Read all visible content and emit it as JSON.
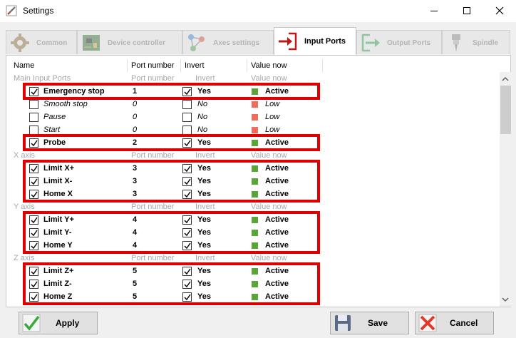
{
  "window": {
    "title": "Settings",
    "icon": "settings-pencil-icon"
  },
  "tabs": [
    {
      "label": "Common",
      "icon": "gear-icon",
      "active": false
    },
    {
      "label": "Device controller",
      "icon": "circuit-board-icon",
      "active": false
    },
    {
      "label": "Axes settings",
      "icon": "axes-nodes-icon",
      "active": false
    },
    {
      "label": "Input Ports",
      "icon": "input-arrow-icon",
      "active": true
    },
    {
      "label": "Output Ports",
      "icon": "output-arrow-icon",
      "active": false
    },
    {
      "label": "Spindle",
      "icon": "spindle-drill-icon",
      "active": false
    }
  ],
  "table": {
    "columns": [
      "Name",
      "Port number",
      "Invert",
      "Value now"
    ],
    "rows": [
      {
        "kind": "group",
        "name": "Main Input Ports",
        "port": "Port number",
        "invert": "Invert",
        "value": "Value now"
      },
      {
        "kind": "signal",
        "enabled": true,
        "name": "Emergency stop",
        "port": "1",
        "invert_checked": true,
        "invert": "Yes",
        "value": "Active",
        "status": "active"
      },
      {
        "kind": "signal",
        "enabled": false,
        "name": "Smooth stop",
        "port": "0",
        "invert_checked": false,
        "invert": "No",
        "value": "Low",
        "status": "low"
      },
      {
        "kind": "signal",
        "enabled": false,
        "name": "Pause",
        "port": "0",
        "invert_checked": false,
        "invert": "No",
        "value": "Low",
        "status": "low"
      },
      {
        "kind": "signal",
        "enabled": false,
        "name": "Start",
        "port": "0",
        "invert_checked": false,
        "invert": "No",
        "value": "Low",
        "status": "low"
      },
      {
        "kind": "signal",
        "enabled": true,
        "name": "Probe",
        "port": "2",
        "invert_checked": true,
        "invert": "Yes",
        "value": "Active",
        "status": "active"
      },
      {
        "kind": "group",
        "name": "X axis",
        "port": "Port number",
        "invert": "Invert",
        "value": "Value now"
      },
      {
        "kind": "signal",
        "enabled": true,
        "name": "Limit X+",
        "port": "3",
        "invert_checked": true,
        "invert": "Yes",
        "value": "Active",
        "status": "active"
      },
      {
        "kind": "signal",
        "enabled": true,
        "name": "Limit X-",
        "port": "3",
        "invert_checked": true,
        "invert": "Yes",
        "value": "Active",
        "status": "active"
      },
      {
        "kind": "signal",
        "enabled": true,
        "name": "Home X",
        "port": "3",
        "invert_checked": true,
        "invert": "Yes",
        "value": "Active",
        "status": "active"
      },
      {
        "kind": "group",
        "name": "Y axis",
        "port": "Port number",
        "invert": "Invert",
        "value": "Value now"
      },
      {
        "kind": "signal",
        "enabled": true,
        "name": "Limit Y+",
        "port": "4",
        "invert_checked": true,
        "invert": "Yes",
        "value": "Active",
        "status": "active"
      },
      {
        "kind": "signal",
        "enabled": true,
        "name": "Limit Y-",
        "port": "4",
        "invert_checked": true,
        "invert": "Yes",
        "value": "Active",
        "status": "active"
      },
      {
        "kind": "signal",
        "enabled": true,
        "name": "Home Y",
        "port": "4",
        "invert_checked": true,
        "invert": "Yes",
        "value": "Active",
        "status": "active"
      },
      {
        "kind": "group",
        "name": "Z axis",
        "port": "Port number",
        "invert": "Invert",
        "value": "Value now"
      },
      {
        "kind": "signal",
        "enabled": true,
        "name": "Limit Z+",
        "port": "5",
        "invert_checked": true,
        "invert": "Yes",
        "value": "Active",
        "status": "active"
      },
      {
        "kind": "signal",
        "enabled": true,
        "name": "Limit Z-",
        "port": "5",
        "invert_checked": true,
        "invert": "Yes",
        "value": "Active",
        "status": "active"
      },
      {
        "kind": "signal",
        "enabled": true,
        "name": "Home Z",
        "port": "5",
        "invert_checked": true,
        "invert": "Yes",
        "value": "Active",
        "status": "active"
      }
    ]
  },
  "buttons": {
    "apply": {
      "label": "Apply",
      "icon": "checkmark-icon"
    },
    "save": {
      "label": "Save",
      "icon": "floppy-disk-icon"
    },
    "cancel": {
      "label": "Cancel",
      "icon": "red-x-icon"
    }
  },
  "colors": {
    "highlight": "#e00000",
    "status_active": "#5aa53a",
    "status_low": "#f06c5a",
    "group_text": "#a8a8a8"
  }
}
